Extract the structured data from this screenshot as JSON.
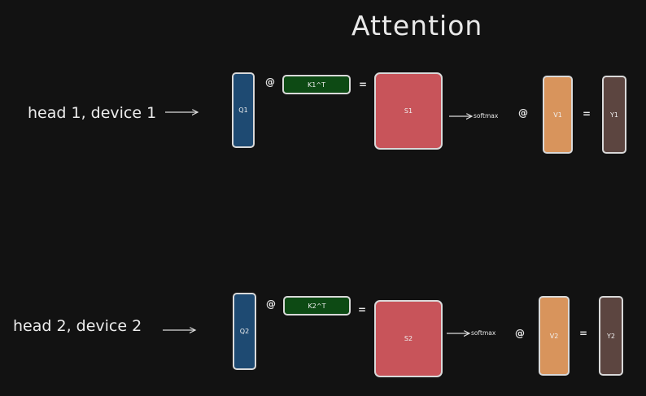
{
  "title": "Attention",
  "colors": {
    "background": "#121212",
    "q": "#1e4a72",
    "k": "#0d4a14",
    "s": "#c8545a",
    "v": "#d8945c",
    "y": "#5c4540"
  },
  "rows": [
    {
      "label": "head 1, device 1",
      "q": "Q1",
      "at1": "@",
      "k": "K1^T",
      "eq1": "=",
      "s": "S1",
      "softmax": "softmax",
      "at2": "@",
      "v": "V1",
      "eq2": "=",
      "y": "Y1"
    },
    {
      "label": "head 2, device 2",
      "q": "Q2",
      "at1": "@",
      "k": "K2^T",
      "eq1": "=",
      "s": "S2",
      "softmax": "softmax",
      "at2": "@",
      "v": "V2",
      "eq2": "=",
      "y": "Y2"
    }
  ]
}
